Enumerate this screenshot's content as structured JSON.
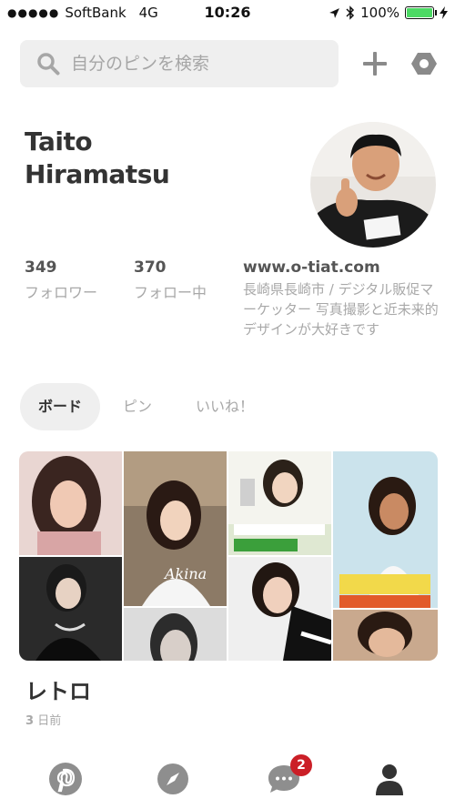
{
  "status": {
    "carrier": "SoftBank",
    "network": "4G",
    "time": "10:26",
    "battery_pct": "100%",
    "battery_level": 1.0
  },
  "search": {
    "placeholder": "自分のピンを検索"
  },
  "profile": {
    "name_line1": "Taito",
    "name_line2": "Hiramatsu",
    "followers_count": "349",
    "followers_label": "フォロワー",
    "following_count": "370",
    "following_label": "フォロー中",
    "website": "www.o-tiat.com",
    "bio": "長崎県長崎市 / デジタル販促マーケッター 写真撮影と近未来的デザインが大好きです"
  },
  "tabs": [
    {
      "label": "ボード",
      "active": true
    },
    {
      "label": "ピン",
      "active": false
    },
    {
      "label": "いいね！",
      "active": false
    }
  ],
  "board": {
    "title": "レトロ",
    "updated_count": "3",
    "updated_unit": "日前"
  },
  "bottom_nav": {
    "items": [
      "pinterest-home-icon",
      "explore-compass-icon",
      "messages-icon",
      "profile-icon"
    ],
    "notification_count": "2"
  },
  "colors": {
    "badge": "#cb1f27",
    "search_bg": "#efefef",
    "battery": "#4cd964"
  }
}
